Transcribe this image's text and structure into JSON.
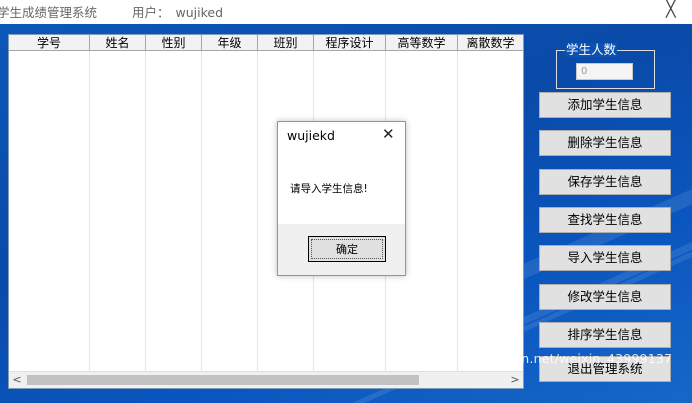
{
  "app": {
    "title": "学生成绩管理系统",
    "user_label": "用户：",
    "user_name": "wujiked",
    "close_glyph": "╳"
  },
  "table": {
    "columns": [
      "学号",
      "姓名",
      "性别",
      "年级",
      "班别",
      "程序设计",
      "高等数学",
      "离散数学"
    ],
    "rows": []
  },
  "scrollbar": {
    "left_arrow": "<",
    "right_arrow": ">"
  },
  "count_box": {
    "legend": "学生人数",
    "value": "0"
  },
  "side_buttons": [
    "添加学生信息",
    "删除学生信息",
    "保存学生信息",
    "查找学生信息",
    "导入学生信息",
    "修改学生信息",
    "排序学生信息",
    "退出管理系统"
  ],
  "dialog": {
    "title": "wujiekd",
    "close_glyph": "✕",
    "message": "请导入学生信息!",
    "ok_label": "确定"
  },
  "watermark": "https://blog.csdn.net/weixin_43999137",
  "colors": {
    "desktop_blue": "#0b52b3",
    "button_face": "#e1e1e1",
    "dialog_footer": "#f0f0f0"
  }
}
